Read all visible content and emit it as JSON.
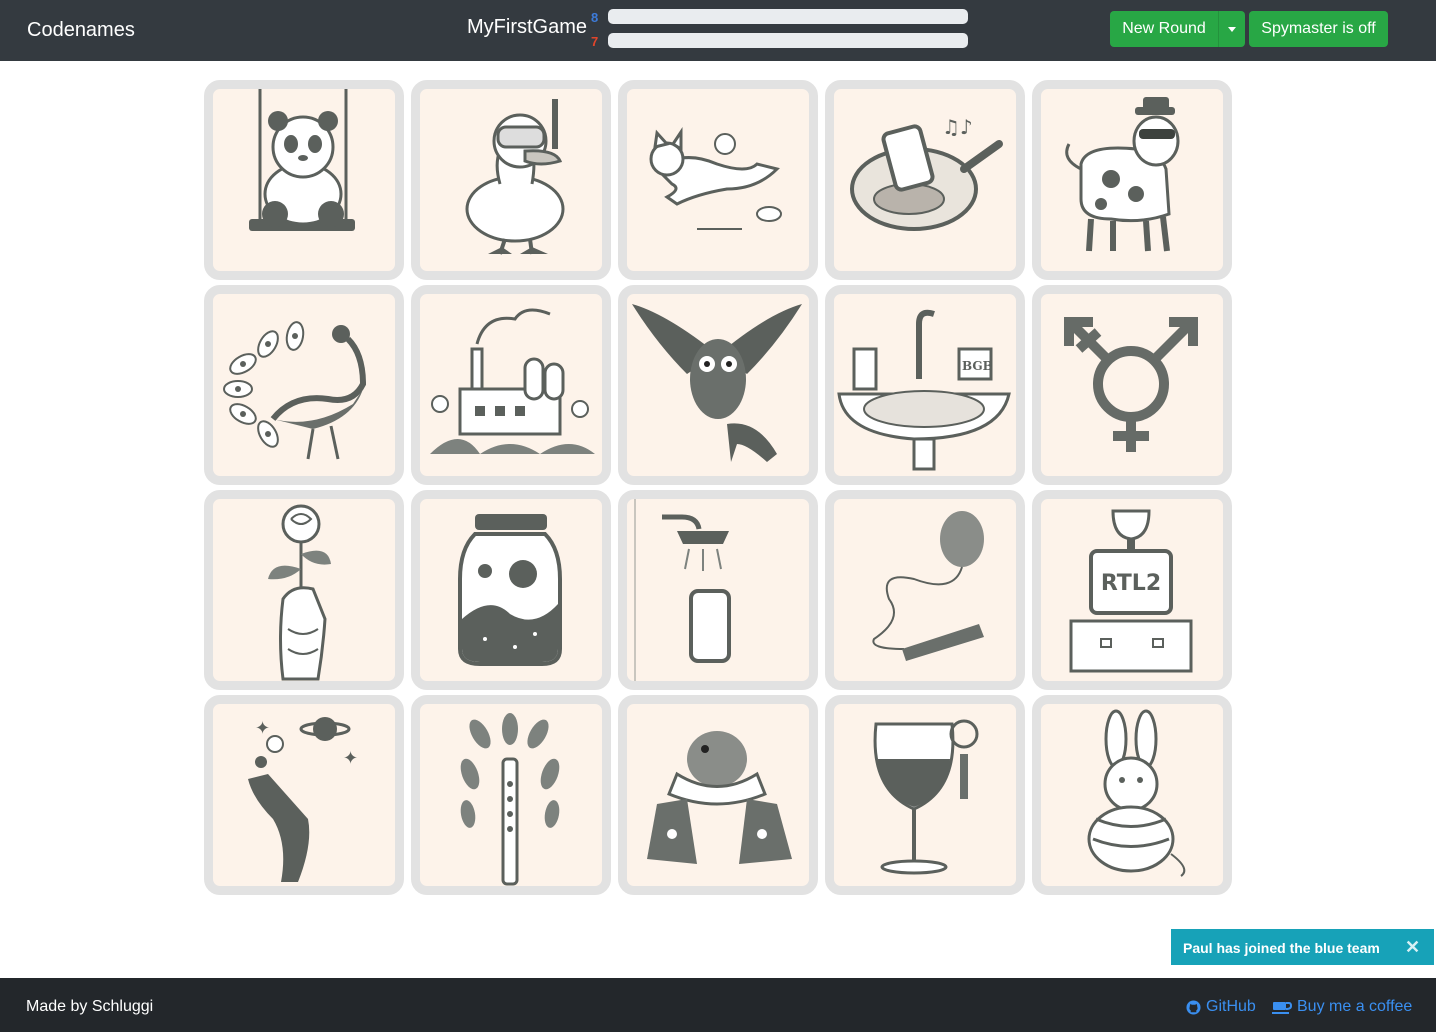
{
  "navbar": {
    "brand": "Codenames",
    "game_name": "MyFirstGame",
    "blue_score": "8",
    "red_score": "7",
    "new_round_label": "New Round",
    "spymaster_label": "Spymaster is off"
  },
  "colors": {
    "navbar_bg": "#343a40",
    "footer_bg": "#23272b",
    "button_green": "#28a745",
    "blue_team": "#3d7bd9",
    "red_team": "#e0452b",
    "toast_bg": "#17a2b8",
    "card_bg": "#fdf3ea",
    "card_border": "#e2e2e2",
    "link_blue": "#3a8ff0"
  },
  "cards": [
    {
      "icon": "panda-on-swing-icon"
    },
    {
      "icon": "duck-with-snorkel-icon"
    },
    {
      "icon": "cat-chasing-mice-icon"
    },
    {
      "icon": "phone-in-frying-pan-icon"
    },
    {
      "icon": "cow-with-hat-and-sunglasses-icon"
    },
    {
      "icon": "peacock-icon"
    },
    {
      "icon": "factory-with-flowers-icon"
    },
    {
      "icon": "owl-with-high-heel-icon"
    },
    {
      "icon": "bathroom-sink-icon"
    },
    {
      "icon": "transgender-symbol-icon"
    },
    {
      "icon": "rose-in-hand-icon"
    },
    {
      "icon": "galaxy-in-jar-icon"
    },
    {
      "icon": "phone-under-shower-icon"
    },
    {
      "icon": "balloon-with-clothespin-icon"
    },
    {
      "icon": "rtl2-trophy-tv-icon"
    },
    {
      "icon": "hand-with-planets-icon"
    },
    {
      "icon": "recorder-flute-with-leaves-icon"
    },
    {
      "icon": "bird-in-scarf-icon"
    },
    {
      "icon": "wine-glass-with-key-icon"
    },
    {
      "icon": "bunny-tied-with-rope-icon"
    }
  ],
  "toast": {
    "message": "Paul has joined the blue team",
    "close_glyph": "✕"
  },
  "footer": {
    "credit": "Made by Schluggi",
    "github_label": "GitHub",
    "coffee_label": "Buy me a coffee"
  }
}
